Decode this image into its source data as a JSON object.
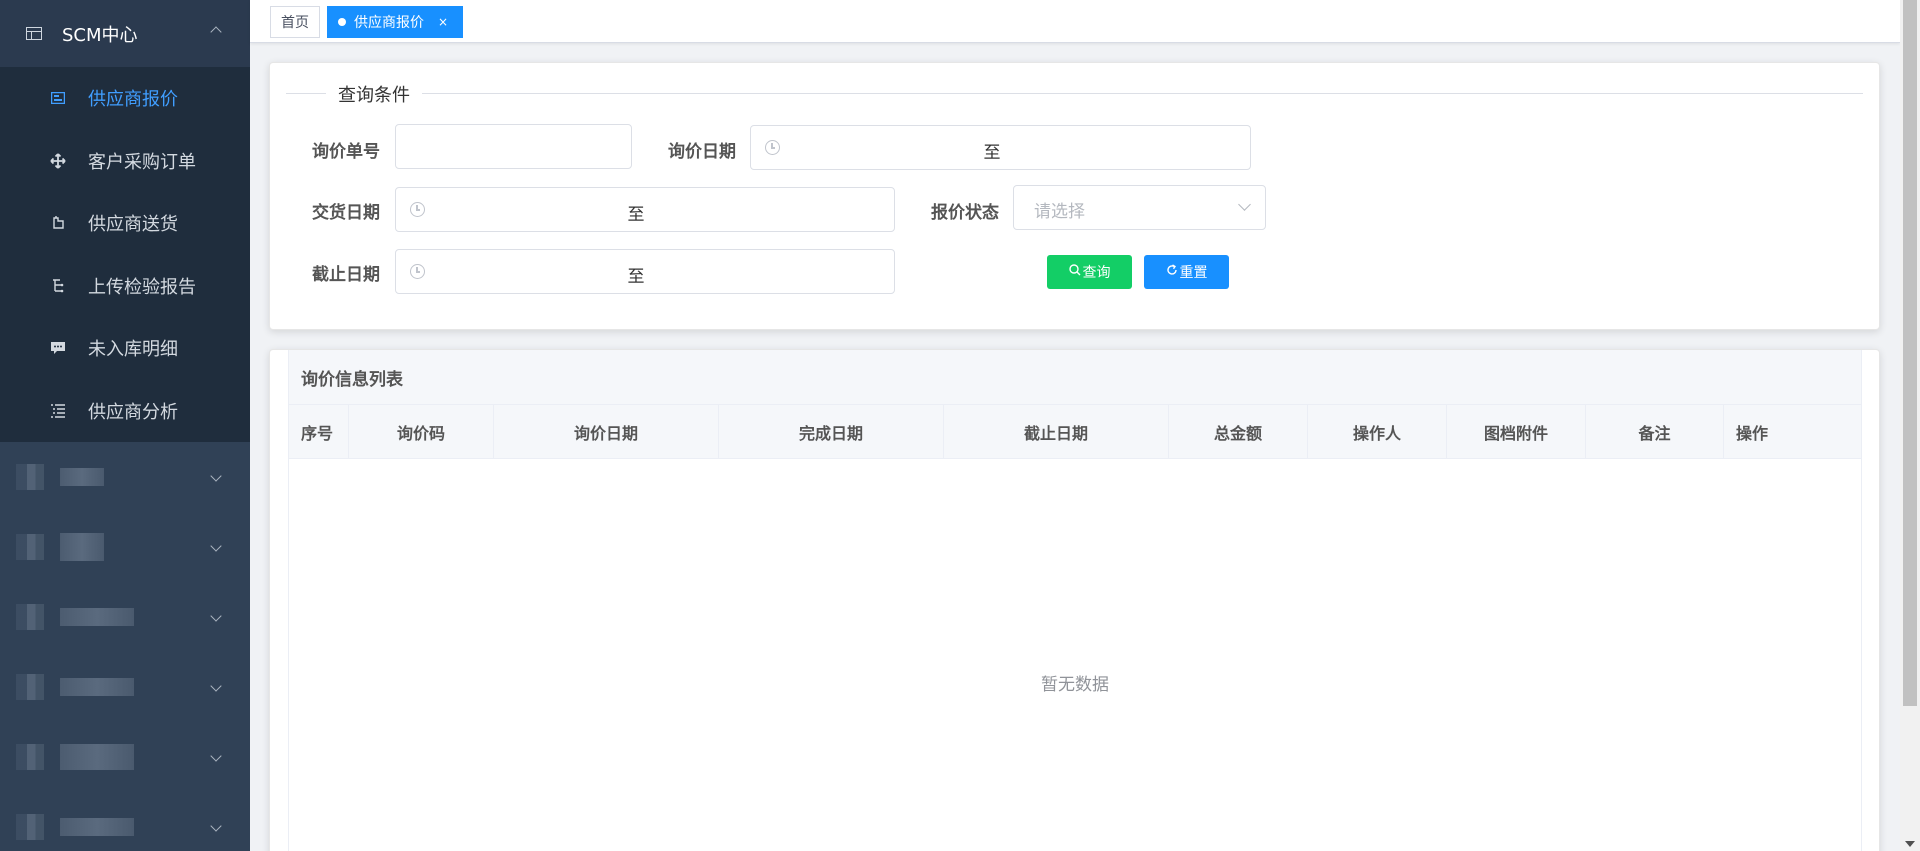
{
  "sidebar": {
    "header_label": "SCM中心",
    "items": [
      {
        "label": "供应商报价",
        "icon": "card-icon",
        "active": true
      },
      {
        "label": "客户采购订单",
        "icon": "move-icon",
        "active": false
      },
      {
        "label": "供应商送货",
        "icon": "delivery-icon",
        "active": false
      },
      {
        "label": "上传检验报告",
        "icon": "tree-icon",
        "active": false
      },
      {
        "label": "未入库明细",
        "icon": "message-icon",
        "active": false
      },
      {
        "label": "供应商分析",
        "icon": "list-icon",
        "active": false
      }
    ]
  },
  "tabs": {
    "home": "首页",
    "current": "供应商报价",
    "close": "×"
  },
  "query": {
    "legend": "查询条件",
    "inquiry_no_label": "询价单号",
    "inquiry_no_value": "",
    "inquiry_date_label": "询价日期",
    "delivery_date_label": "交货日期",
    "deadline_label": "截止日期",
    "status_label": "报价状态",
    "status_placeholder": "请选择",
    "range_sep": "至",
    "search_button": "查询",
    "reset_button": "重置"
  },
  "table": {
    "title": "询价信息列表",
    "columns": [
      "序号",
      "询价码",
      "询价日期",
      "完成日期",
      "截止日期",
      "总金额",
      "操作人",
      "图档附件",
      "备注",
      "操作"
    ],
    "empty_text": "暂无数据"
  },
  "colors": {
    "sidebar_bg": "#304156",
    "submenu_bg": "#1f2d3d",
    "accent": "#1890ff",
    "success": "#13ce66"
  }
}
